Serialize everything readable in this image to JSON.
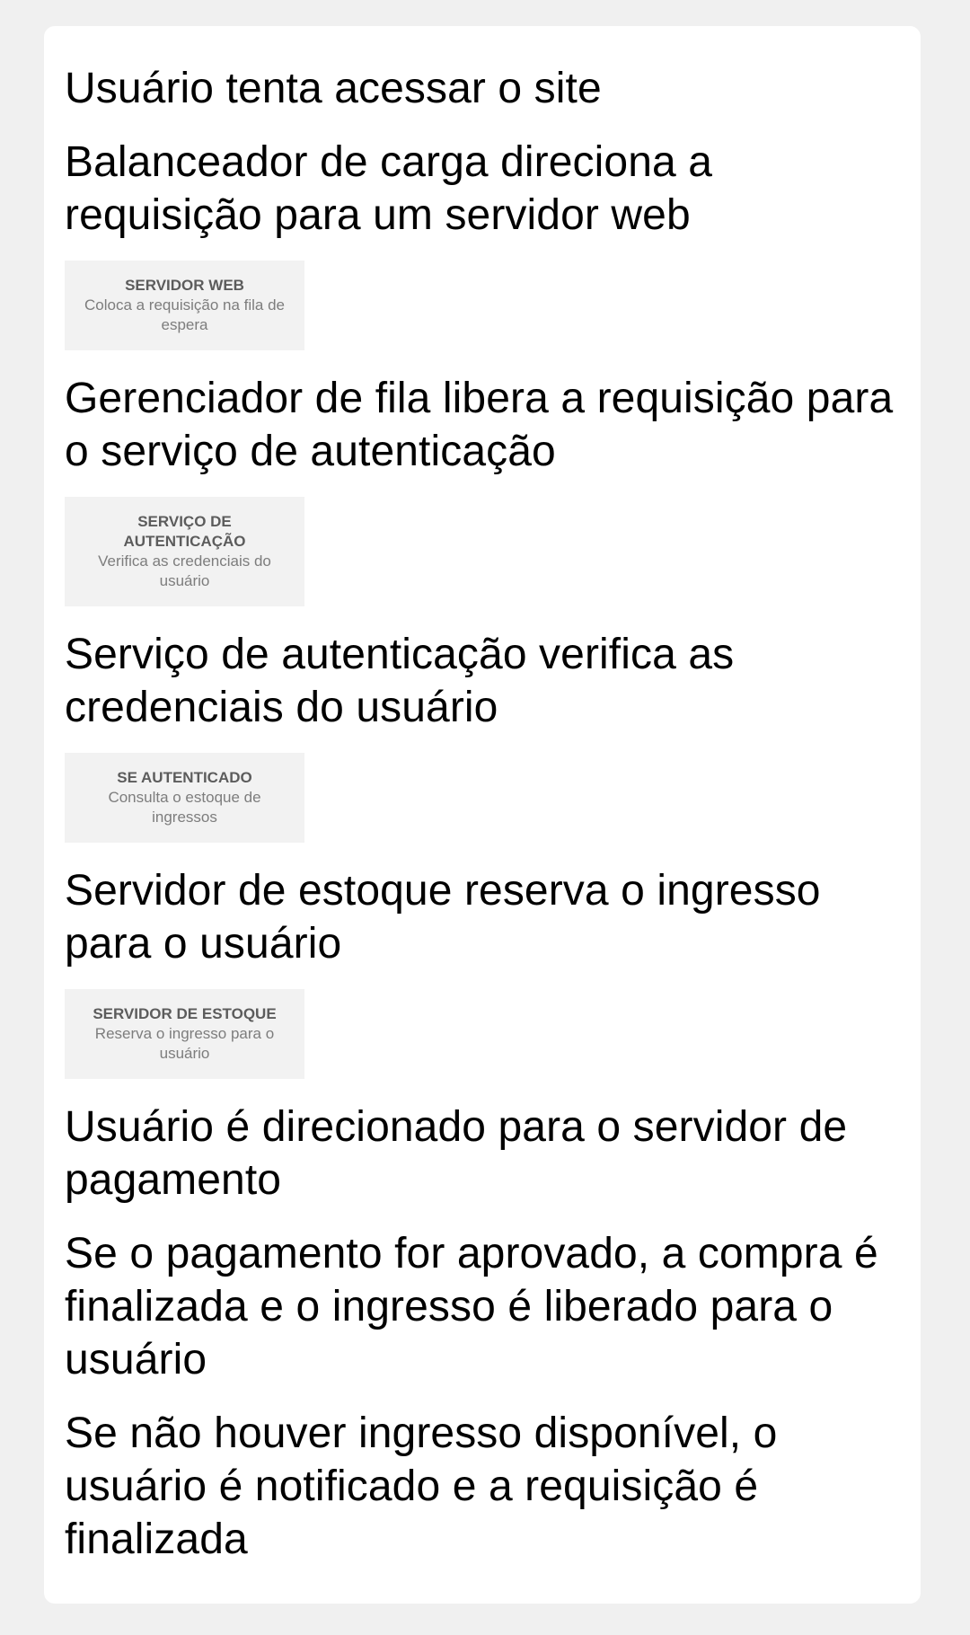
{
  "steps": [
    {
      "text": "Usuário tenta acessar o site"
    },
    {
      "text": "Balanceador de carga direciona a requisição para um servidor web",
      "box": {
        "title": "SERVIDOR WEB",
        "desc": "Coloca a requisição na fila de espera"
      }
    },
    {
      "text": "Gerenciador de fila libera a requisição para o serviço de autenticação",
      "box": {
        "title": "SERVIÇO DE AUTENTICAÇÃO",
        "desc": "Verifica as credenciais do usuário"
      }
    },
    {
      "text": "Serviço de autenticação verifica as credenciais do usuário",
      "box": {
        "title": "SE AUTENTICADO",
        "desc": "Consulta o estoque de ingressos"
      }
    },
    {
      "text": "Servidor de estoque reserva o ingresso para o usuário",
      "box": {
        "title": "SERVIDOR DE ESTOQUE",
        "desc": "Reserva o ingresso para o usuário"
      }
    },
    {
      "text": "Usuário é direcionado para o servidor de pagamento"
    },
    {
      "text": "Se o pagamento for aprovado, a compra é finalizada e o ingresso é liberado para o usuário"
    },
    {
      "text": "Se não houver ingresso disponível, o usuário é notificado e a requisição é finalizada"
    }
  ]
}
